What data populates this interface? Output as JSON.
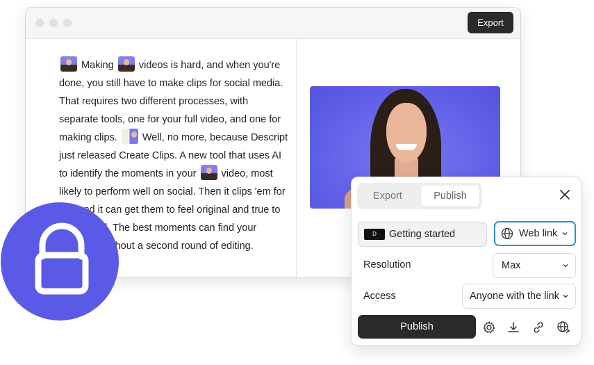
{
  "window": {
    "export_label": "Export"
  },
  "script": {
    "segments": [
      {
        "type": "thumb"
      },
      {
        "type": "text",
        "text": " Making "
      },
      {
        "type": "thumb"
      },
      {
        "type": "text",
        "text": " videos is hard, and when you're done, you still have to make clips for social media. That requires two different processes, with separate tools, one for your full video, and one for making clips. "
      },
      {
        "type": "thumb-doc"
      },
      {
        "type": "text",
        "text": " Well, no more, because Descript just released Create Clips. A new tool that uses AI to identify the moments in your "
      },
      {
        "type": "thumb"
      },
      {
        "type": "text",
        "text": " video, most likely to perform well on social. Then it clips 'em for you and it can get them to feel original and true to your brand. The best moments can find your audience without a second round of editing."
      }
    ]
  },
  "panel": {
    "tabs": [
      {
        "label": "Export",
        "active": false
      },
      {
        "label": "Publish",
        "active": true
      }
    ],
    "project_name": "Getting started",
    "project_thumb_letter": "D",
    "destination": "Web link",
    "resolution_label": "Resolution",
    "resolution_value": "Max",
    "access_label": "Access",
    "access_value": "Anyone with the link",
    "publish_label": "Publish",
    "tool_icons": [
      "gear-icon",
      "download-icon",
      "link-icon",
      "globe-icon"
    ]
  },
  "colors": {
    "accent": "#5a5ae6",
    "dark_button": "#2a2a2a",
    "focus_ring": "#2f8fd0"
  }
}
